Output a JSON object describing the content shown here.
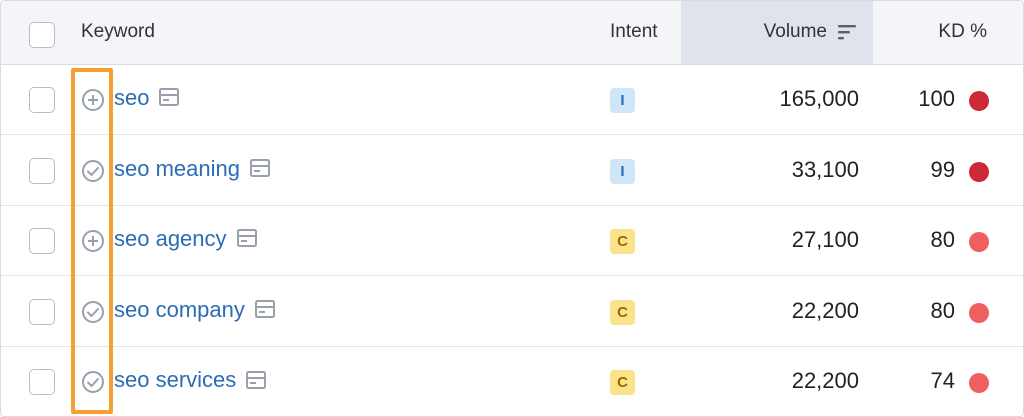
{
  "header": {
    "keyword_label": "Keyword",
    "intent_label": "Intent",
    "volume_label": "Volume",
    "kd_label": "KD %"
  },
  "rows": [
    {
      "status_icon": "plus-circle-icon",
      "keyword": "seo",
      "intent": "I",
      "volume": "165,000",
      "kd": "100",
      "kd_color": "#cc2a36"
    },
    {
      "status_icon": "check-circle-icon",
      "keyword": "seo meaning",
      "intent": "I",
      "volume": "33,100",
      "kd": "99",
      "kd_color": "#cc2a36"
    },
    {
      "status_icon": "plus-circle-icon",
      "keyword": "seo agency",
      "intent": "C",
      "volume": "27,100",
      "kd": "80",
      "kd_color": "#ee5f5f"
    },
    {
      "status_icon": "check-circle-icon",
      "keyword": "seo company",
      "intent": "C",
      "volume": "22,200",
      "kd": "80",
      "kd_color": "#ee5f5f"
    },
    {
      "status_icon": "check-circle-icon",
      "keyword": "seo services",
      "intent": "C",
      "volume": "22,200",
      "kd": "74",
      "kd_color": "#ee5f5f"
    }
  ],
  "colors": {
    "link": "#2b6cb8",
    "highlight": "#f5a030",
    "intent_I_bg": "#cfe6f8",
    "intent_C_bg": "#fbe38b"
  }
}
